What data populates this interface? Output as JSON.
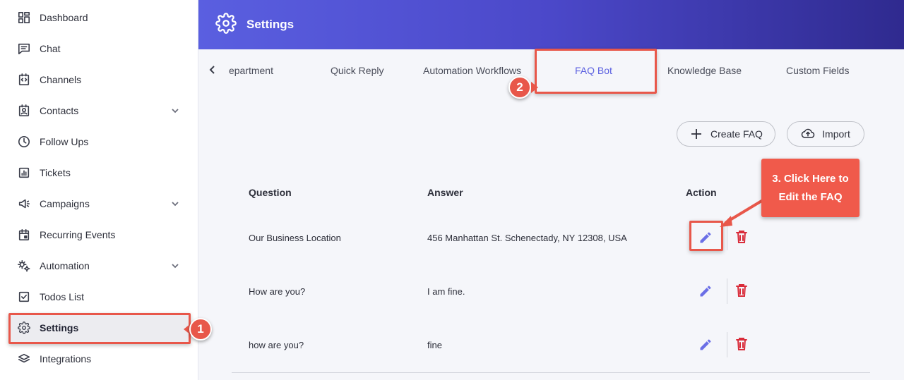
{
  "sidebar": {
    "items": [
      {
        "label": "Dashboard",
        "icon": "dashboard-icon"
      },
      {
        "label": "Chat",
        "icon": "chat-icon"
      },
      {
        "label": "Channels",
        "icon": "channels-icon"
      },
      {
        "label": "Contacts",
        "icon": "contacts-icon",
        "expandable": true
      },
      {
        "label": "Follow Ups",
        "icon": "clock-icon"
      },
      {
        "label": "Tickets",
        "icon": "tickets-icon"
      },
      {
        "label": "Campaigns",
        "icon": "megaphone-icon",
        "expandable": true
      },
      {
        "label": "Recurring Events",
        "icon": "calendar-icon"
      },
      {
        "label": "Automation",
        "icon": "cogs-icon",
        "expandable": true
      },
      {
        "label": "Todos List",
        "icon": "checkbox-icon"
      },
      {
        "label": "Settings",
        "icon": "gear-icon",
        "active": true
      },
      {
        "label": "Integrations",
        "icon": "layers-icon"
      }
    ]
  },
  "header": {
    "title": "Settings"
  },
  "tabs": {
    "items": [
      {
        "label": "Department",
        "visible_text": "epartment"
      },
      {
        "label": "Quick Reply"
      },
      {
        "label": "Automation Workflows"
      },
      {
        "label": "FAQ Bot",
        "active": true
      },
      {
        "label": "Knowledge Base"
      },
      {
        "label": "Custom Fields"
      }
    ]
  },
  "actions": {
    "create_label": "Create FAQ",
    "import_label": "Import"
  },
  "table": {
    "columns": [
      "Question",
      "Answer",
      "Action"
    ],
    "rows": [
      {
        "question": "Our Business Location",
        "answer": "456 Manhattan St. Schenectady, NY 12308, USA"
      },
      {
        "question": "How are you?",
        "answer": "I am fine."
      },
      {
        "question": "how are you?",
        "answer": "fine"
      }
    ]
  },
  "annotations": {
    "step1": "1",
    "step2": "2",
    "step3_line1": "3. Click Here to",
    "step3_line2": "Edit the FAQ",
    "highlight_color": "#e8574a"
  },
  "colors": {
    "accent": "#5a5fe0",
    "delete": "#d92c3a",
    "header_start": "#5a5fe0",
    "header_end": "#2f2a8f"
  }
}
